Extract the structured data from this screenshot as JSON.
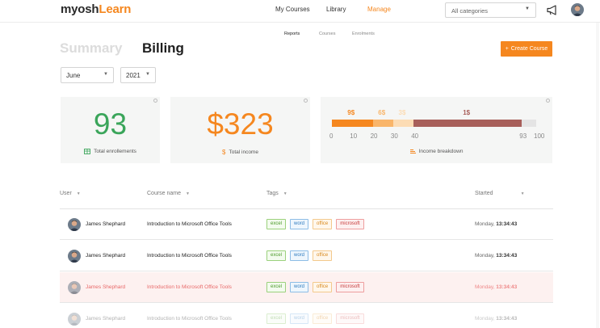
{
  "header": {
    "logo_part1": "myosh",
    "logo_part2": "Learn",
    "nav": [
      "My Courses",
      "Library",
      "Manage"
    ],
    "category_select": "All categories"
  },
  "subtabs": [
    "Reports",
    "Courses",
    "Enrolments"
  ],
  "page": {
    "title_summary": "Summary",
    "title_billing": "Billing",
    "create_button": "Create Course",
    "create_button_icon": "+",
    "month": "June",
    "year": "2021"
  },
  "cards": {
    "enrollments_value": "93",
    "enrollments_label": "Total enrollements",
    "income_value": "$323",
    "income_label": "Total income",
    "income_icon": "$",
    "breakdown_label": "Income breakdown",
    "breakdown_values": [
      "9$",
      "6$",
      "3$",
      "1$"
    ],
    "breakdown_segments": [
      {
        "label": "9$",
        "from": 0,
        "to": 20,
        "color": "#f5871f"
      },
      {
        "label": "6$",
        "from": 20,
        "to": 30,
        "color": "#f9b56a"
      },
      {
        "label": "3$",
        "from": 30,
        "to": 40,
        "color": "#fcdcb4"
      },
      {
        "label": "1$",
        "from": 40,
        "to": 93,
        "color": "#a85f5a"
      },
      {
        "label": "",
        "from": 93,
        "to": 100,
        "color": "#e4e4e4"
      }
    ],
    "breakdown_ticks": [
      "0",
      "10",
      "20",
      "30",
      "40",
      "93",
      "100"
    ]
  },
  "table": {
    "headers": [
      "User",
      "Course name",
      "Tags",
      "Started"
    ],
    "rows": [
      {
        "user": "James Shephard",
        "course": "Introduction to Microsoft Office Tools",
        "tags": [
          "excel",
          "word",
          "office",
          "microsoft"
        ],
        "started_day": "Monday,",
        "started_time": "13:34:43"
      },
      {
        "user": "James Shephard",
        "course": "Introduction to Microsoft Office Tools",
        "tags": [
          "excel",
          "word",
          "office"
        ],
        "started_day": "Monday,",
        "started_time": "13:34:43"
      },
      {
        "user": "James Shephard",
        "course": "Introduction to Microsoft Office Tools",
        "tags": [
          "excel",
          "word",
          "office",
          "microsoft"
        ],
        "started_day": "Monday,",
        "started_time": "13:34:43"
      },
      {
        "user": "James Shephard",
        "course": "Introduction to Microsoft Office Tools",
        "tags": [
          "excel",
          "word",
          "office",
          "microsoft"
        ],
        "started_day": "Monday,",
        "started_time": "13:34:43"
      }
    ]
  },
  "colors": {
    "accent": "#f5871f",
    "enrollments": "#3aa55a",
    "income": "#f5871f"
  }
}
